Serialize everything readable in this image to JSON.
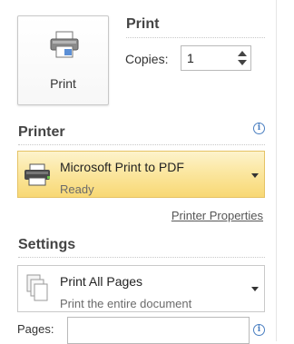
{
  "print_section": {
    "button_label": "Print",
    "heading": "Print",
    "copies_label": "Copies:",
    "copies_value": "1"
  },
  "printer_section": {
    "heading": "Printer",
    "selected_printer": "Microsoft Print to PDF",
    "status": "Ready",
    "properties_link": "Printer Properties",
    "info_icon": "i"
  },
  "settings_section": {
    "heading": "Settings",
    "pages_option_title": "Print All Pages",
    "pages_option_subtitle": "Print the entire document",
    "pages_label": "Pages:",
    "pages_value": "",
    "info_icon": "i"
  },
  "colors": {
    "selected_printer_bg": "#fbe7a1",
    "selected_printer_border": "#e5c365",
    "info_blue": "#4a7fc1"
  }
}
